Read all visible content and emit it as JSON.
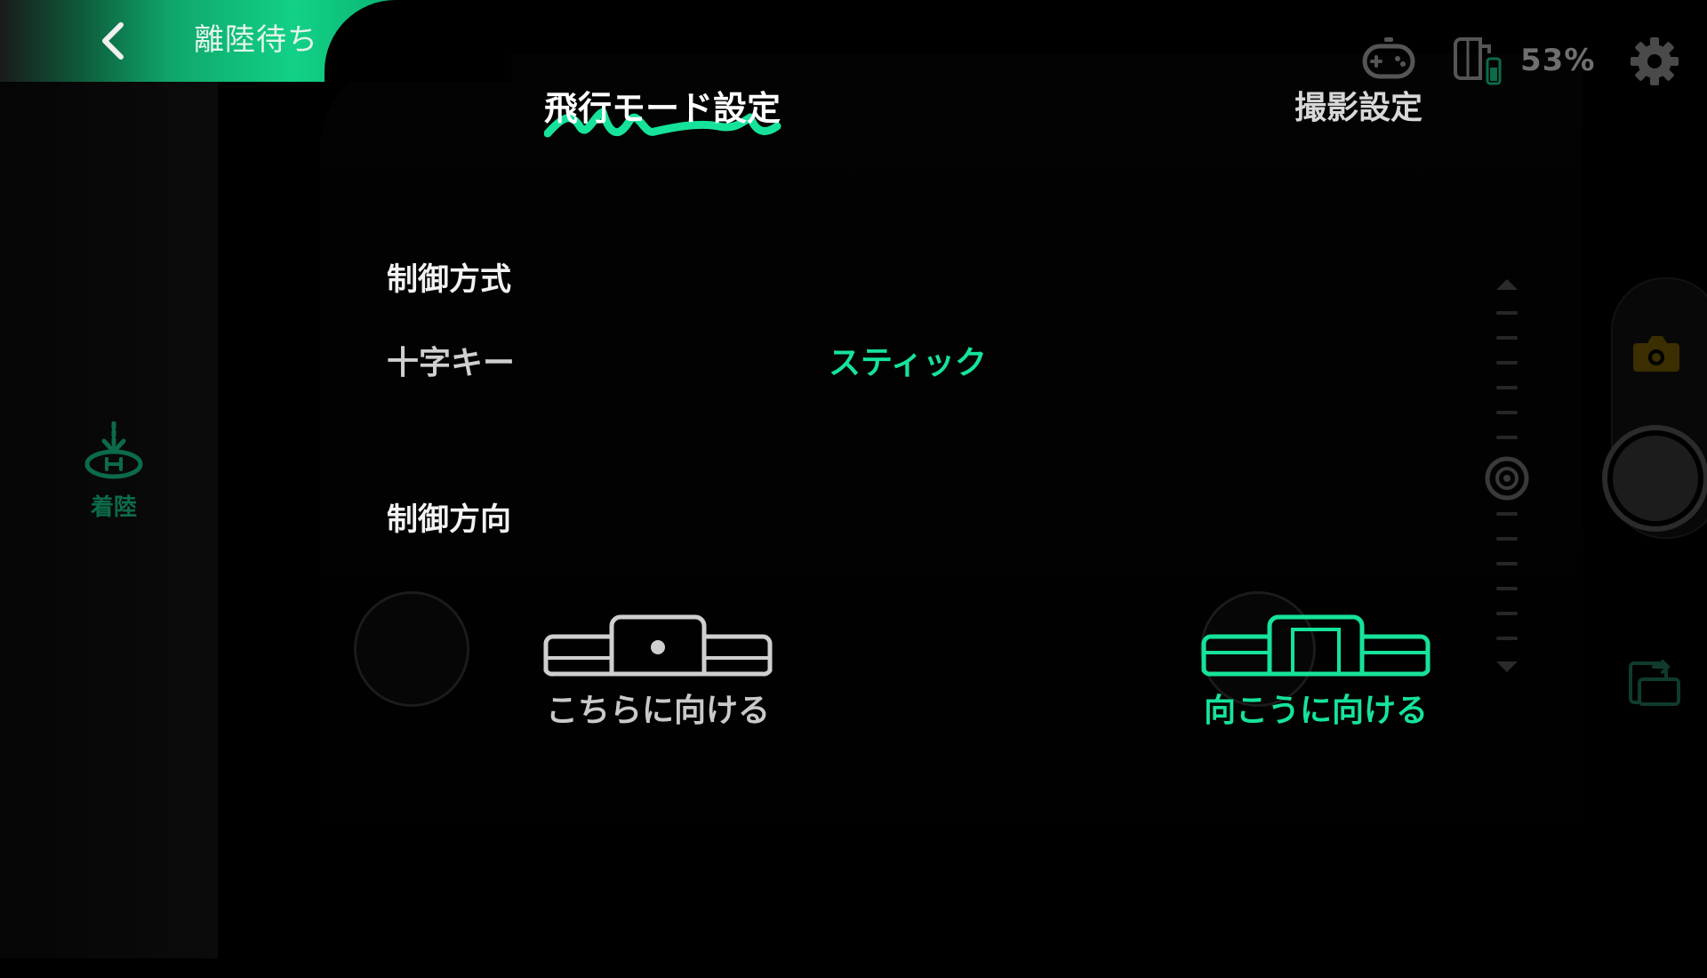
{
  "status": {
    "text": "離陸待ち",
    "back_icon": "chevron-left-icon"
  },
  "tabs": [
    {
      "label": "飛行モード設定",
      "active": true
    },
    {
      "label": "撮影設定",
      "active": false
    }
  ],
  "indicators": {
    "gamepad_icon": "gamepad-icon",
    "battery_icon": "battery-icon",
    "battery_percent": "53%",
    "settings_icon": "gear-icon"
  },
  "landing": {
    "label": "着陸",
    "icon": "landing-icon"
  },
  "control_method": {
    "title": "制御方式",
    "options": [
      {
        "label": "十字キー",
        "selected": false
      },
      {
        "label": "スティック",
        "selected": true
      }
    ]
  },
  "control_direction": {
    "title": "制御方向",
    "options": [
      {
        "label": "こちらに向ける",
        "selected": false
      },
      {
        "label": "向こうに向ける",
        "selected": true
      }
    ]
  },
  "colors": {
    "accent": "#16e39a",
    "accent_dark": "#0c6b49",
    "background": "#000000",
    "text_muted": "#cfcfcf"
  }
}
